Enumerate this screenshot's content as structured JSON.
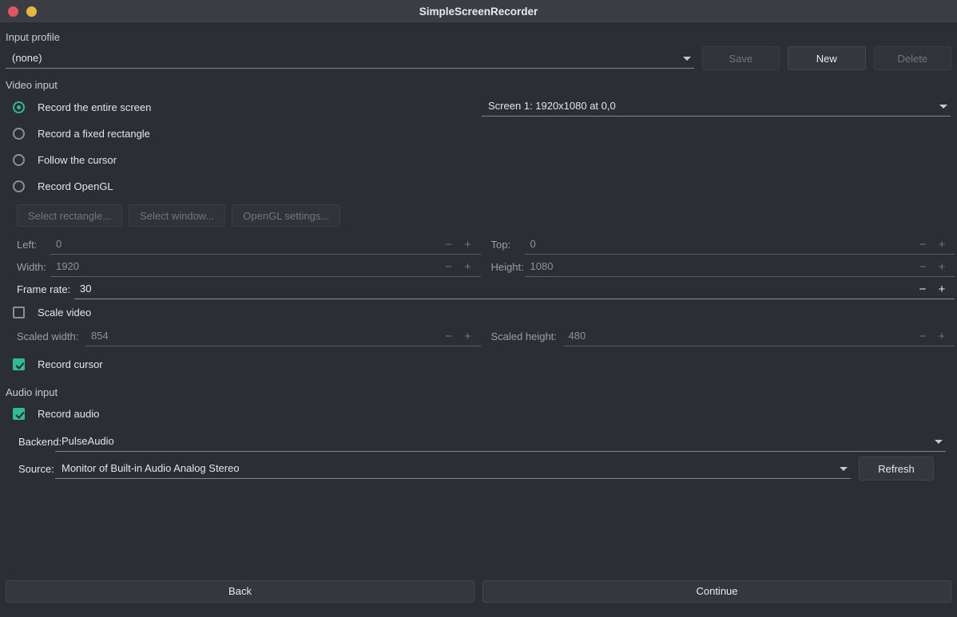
{
  "window": {
    "title": "SimpleScreenRecorder",
    "close_icon": "close-dot",
    "minimize_icon": "minimize-dot"
  },
  "input_profile": {
    "section_label": "Input profile",
    "selected": "(none)",
    "save_label": "Save",
    "new_label": "New",
    "delete_label": "Delete"
  },
  "video_input": {
    "section_label": "Video input",
    "options": [
      {
        "label": "Record the entire screen",
        "selected": true
      },
      {
        "label": "Record a fixed rectangle",
        "selected": false
      },
      {
        "label": "Follow the cursor",
        "selected": false
      },
      {
        "label": "Record OpenGL",
        "selected": false
      }
    ],
    "screen_selector": "Screen 1: 1920x1080 at 0,0",
    "buttons": {
      "select_rectangle": "Select rectangle...",
      "select_window": "Select window...",
      "opengl_settings": "OpenGL settings..."
    },
    "geometry": {
      "left_label": "Left:",
      "left_value": "0",
      "top_label": "Top:",
      "top_value": "0",
      "width_label": "Width:",
      "width_value": "1920",
      "height_label": "Height:",
      "height_value": "1080"
    },
    "frame_rate_label": "Frame rate:",
    "frame_rate_value": "30",
    "scale_video_label": "Scale video",
    "scale_video_checked": false,
    "scaled_width_label": "Scaled width:",
    "scaled_width_value": "854",
    "scaled_height_label": "Scaled height:",
    "scaled_height_value": "480",
    "record_cursor_label": "Record cursor",
    "record_cursor_checked": true
  },
  "audio_input": {
    "section_label": "Audio input",
    "record_audio_label": "Record audio",
    "record_audio_checked": true,
    "backend_label": "Backend:",
    "backend_value": "PulseAudio",
    "source_label": "Source:",
    "source_value": "Monitor of Built-in Audio Analog Stereo",
    "refresh_label": "Refresh"
  },
  "footer": {
    "back_label": "Back",
    "continue_label": "Continue"
  },
  "colors": {
    "accent": "#2ebd92",
    "background": "#2b2e33",
    "titlebar": "#3a3d43",
    "close": "#e05561",
    "minimize": "#e5b83c"
  }
}
